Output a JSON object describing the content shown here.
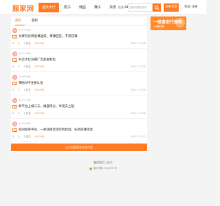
{
  "header": {
    "logo": "服家网",
    "nav": [
      "首页大厅",
      "帮子",
      "佣益",
      "赚子",
      "资讯",
      "APP下载"
    ],
    "active_index": 0,
    "search_select": "任务",
    "search_placeholder": "搜索你要的任务",
    "post_button": "发布需求",
    "auth": "登录 注册"
  },
  "tabs": {
    "items": [
      "最新",
      "最新"
    ],
    "active_index": 0
  },
  "items": [
    {
      "user": "11*****85",
      "tag": "进",
      "title": "文库可兑转发薄送或，薄薄回答，不获获薄",
      "comments": "0",
      "views": "0",
      "status": "1.回复",
      "amount": "¥1.00元",
      "date": "06-21 11:30"
    },
    {
      "user": "11*****85",
      "tag": "进",
      "title": "外卖大红包看广告获金利位",
      "comments": "0",
      "views": "0",
      "status": "1.回复",
      "amount": "¥1.00元",
      "date": "06-21 11:29"
    },
    {
      "user": "11*****85",
      "tag": "进",
      "title": "薄防APP注册认证",
      "comments": "0",
      "views": "0",
      "status": "1.回复",
      "amount": "¥1.00元",
      "date": "06-21 11:29"
    },
    {
      "user": "11*****85",
      "tag": "进",
      "title": "新平台上线三天，做题得分，享受去上陌",
      "comments": "0",
      "views": "0",
      "status": "1.回复",
      "amount": "¥1.00元",
      "date": "06-21 11:28"
    },
    {
      "user": "11*****85",
      "tag": "进",
      "title": "空间程序平台，一款非衡及瑞可利利话，任务回薄话话",
      "comments": "0",
      "views": "0",
      "status": "1.回复",
      "amount": "¥1.00元",
      "date": "06-21 11:27"
    }
  ],
  "more_button": "点击加载更多任务内容",
  "banner": {
    "line1": "一级套宏代理商",
    "line2": "火爆招募"
  },
  "footer": {
    "line1": "服家首页 | 关于",
    "line2": "服ICP备17014937号"
  },
  "colors": {
    "accent": "#ff7a22",
    "background": "#f4f4f4"
  },
  "icons": {
    "search": "search-icon",
    "police": "police-badge-icon"
  }
}
